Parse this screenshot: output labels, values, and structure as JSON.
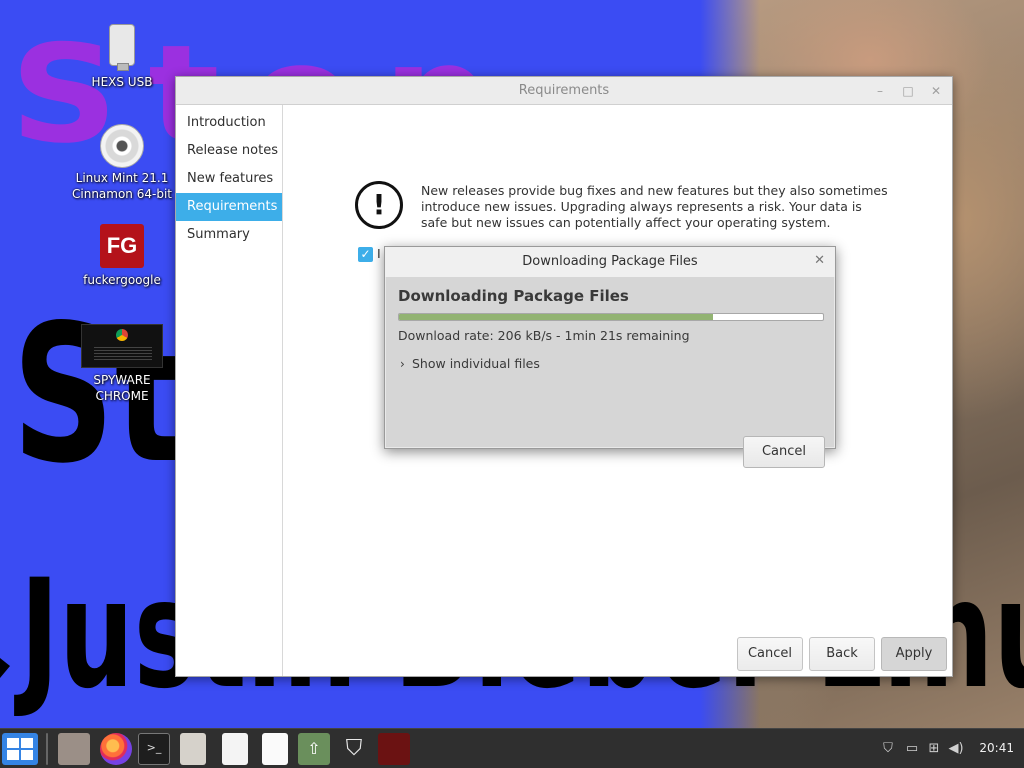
{
  "wallpaper": {
    "word_stop_top": "Stop",
    "word_stop_left": "Stop",
    "word_line2": "Justin Bieber Linux!"
  },
  "desktop_icons": [
    {
      "label": "HEXS USB",
      "icon": "usb-drive-icon"
    },
    {
      "label": "Linux Mint 21.1 Cinnamon 64-bit",
      "icon": "cd-icon"
    },
    {
      "label": "fuckergoogle",
      "icon": "fg-app-icon"
    },
    {
      "label": "SPYWARE CHROME",
      "icon": "chrome-thumbnail-icon"
    }
  ],
  "main_window": {
    "title": "Requirements",
    "sidebar": [
      {
        "label": "Introduction",
        "selected": false
      },
      {
        "label": "Release notes",
        "selected": false
      },
      {
        "label": "New features",
        "selected": false
      },
      {
        "label": "Requirements",
        "selected": true
      },
      {
        "label": "Summary",
        "selected": false
      }
    ],
    "warning_icon": "!",
    "warning_text": "New releases provide bug fixes and new features but they also sometimes introduce new issues. Upgrading always represents a risk. Your data is safe but new issues can potentially affect your operating system.",
    "confirm_checkbox_checked": true,
    "confirm_label_visible": "I",
    "buttons": {
      "cancel": "Cancel",
      "back": "Back",
      "apply": "Apply"
    }
  },
  "download_dialog": {
    "title": "Downloading Package Files",
    "heading": "Downloading Package Files",
    "progress_fraction": 0.74,
    "rate_text": "Download rate: 206 kB/s - 1min 21s remaining",
    "expander_label": "Show individual files",
    "cancel_label": "Cancel"
  },
  "taskbar": {
    "clock": "20:41",
    "apps": [
      "menu-icon",
      "file-manager-icon",
      "firefox-icon",
      "terminal-icon",
      "archive-icon",
      "zip-icon",
      "text-editor-icon",
      "update-manager-icon",
      "shield-icon",
      "red-app-icon"
    ],
    "tray": [
      "shield-tray-icon",
      "display-tray-icon",
      "network-tray-icon",
      "volume-tray-icon"
    ]
  },
  "colors": {
    "wallpaper_blue": "#3b4cf3",
    "selection_blue": "#3daee9",
    "progress_green": "#92b372",
    "taskbar": "#2f2f2f"
  }
}
